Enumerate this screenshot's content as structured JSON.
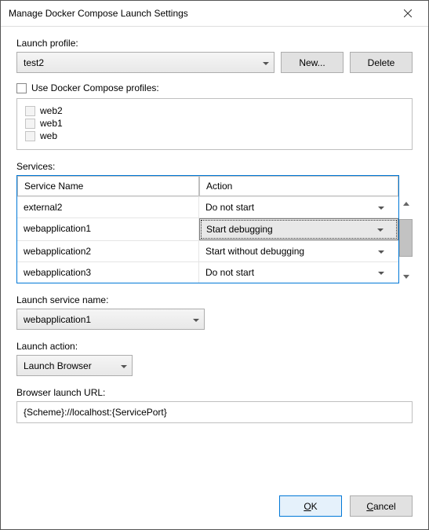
{
  "window": {
    "title": "Manage Docker Compose Launch Settings"
  },
  "launchProfile": {
    "label": "Launch profile:",
    "value": "test2",
    "newLabel": "New...",
    "deleteLabel": "Delete"
  },
  "useProfiles": {
    "label": "Use Docker Compose profiles:",
    "items": [
      {
        "name": "web2"
      },
      {
        "name": "web1"
      },
      {
        "name": "web"
      }
    ]
  },
  "services": {
    "label": "Services:",
    "headers": {
      "name": "Service Name",
      "action": "Action"
    },
    "rows": [
      {
        "name": "external2",
        "action": "Do not start",
        "selected": false
      },
      {
        "name": "webapplication1",
        "action": "Start debugging",
        "selected": true
      },
      {
        "name": "webapplication2",
        "action": "Start without debugging",
        "selected": false
      },
      {
        "name": "webapplication3",
        "action": "Do not start",
        "selected": false
      }
    ]
  },
  "launchServiceName": {
    "label": "Launch service name:",
    "value": "webapplication1"
  },
  "launchAction": {
    "label": "Launch action:",
    "value": "Launch Browser"
  },
  "browserUrl": {
    "label": "Browser launch URL:",
    "value": "{Scheme}://localhost:{ServicePort}"
  },
  "buttons": {
    "ok": "OK",
    "cancel": "Cancel"
  }
}
